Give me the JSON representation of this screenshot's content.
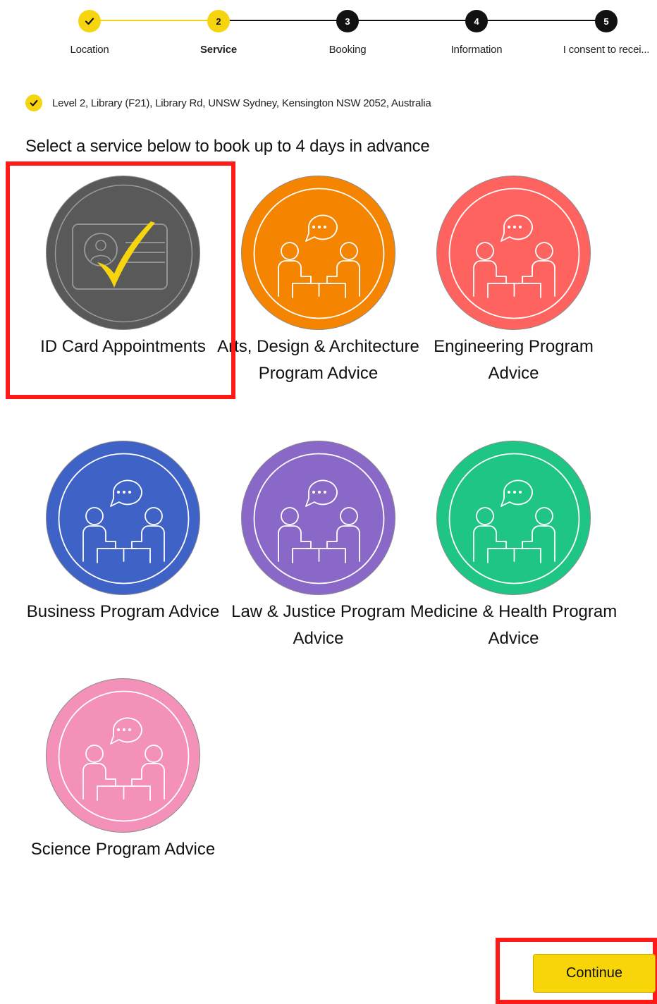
{
  "stepper": {
    "steps": [
      {
        "number": "",
        "label": "Location",
        "state": "done"
      },
      {
        "number": "2",
        "label": "Service",
        "state": "current"
      },
      {
        "number": "3",
        "label": "Booking",
        "state": "todo"
      },
      {
        "number": "4",
        "label": "Information",
        "state": "todo"
      },
      {
        "number": "5",
        "label": "I consent to recei...",
        "state": "todo"
      }
    ]
  },
  "location": {
    "text": "Level 2, Library (F21), Library Rd, UNSW Sydney, Kensington NSW 2052, Australia"
  },
  "heading": "Select a service below to book up to 4 days in advance",
  "services": [
    {
      "name": "ID Card Appointments",
      "color": "#595959",
      "icon": "id-card-check-icon",
      "selected": true
    },
    {
      "name": "Arts, Design & Architecture Program Advice",
      "color": "#f58500",
      "icon": "consultation-icon",
      "selected": false
    },
    {
      "name": "Engineering Program Advice",
      "color": "#ff6360",
      "icon": "consultation-icon",
      "selected": false
    },
    {
      "name": "Business Program Advice",
      "color": "#3f62c6",
      "icon": "consultation-icon",
      "selected": false
    },
    {
      "name": "Law & Justice Program Advice",
      "color": "#8a68c8",
      "icon": "consultation-icon",
      "selected": false
    },
    {
      "name": "Medicine & Health Program Advice",
      "color": "#1fc585",
      "icon": "consultation-icon",
      "selected": false
    },
    {
      "name": "Science Program Advice",
      "color": "#f391b9",
      "icon": "consultation-icon",
      "selected": false
    }
  ],
  "continue_label": "Continue",
  "colors": {
    "accent_yellow": "#f6d50f",
    "highlight_red": "#ff1a1a"
  }
}
